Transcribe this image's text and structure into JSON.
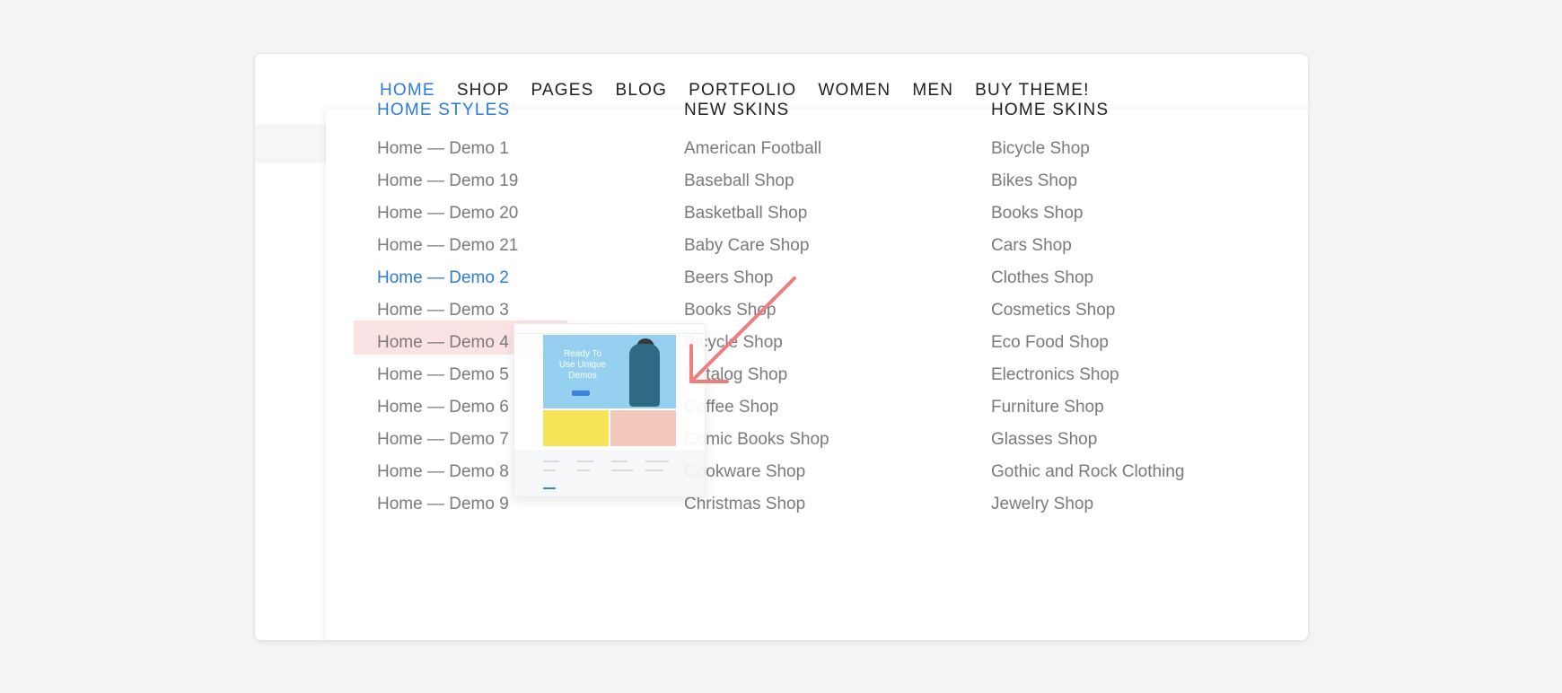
{
  "nav": {
    "items": [
      "HOME",
      "SHOP",
      "PAGES",
      "BLOG",
      "PORTFOLIO",
      "WOMEN",
      "MEN",
      "BUY THEME!"
    ],
    "active_index": 0
  },
  "menu": {
    "columns": [
      {
        "title": "HOME STYLES",
        "items": [
          "Home — Demo 1",
          "Home — Demo 19",
          "Home — Demo 20",
          "Home — Demo 21",
          "Home — Demo 2",
          "Home — Demo 3",
          "Home — Demo 4",
          "Home — Demo 5",
          "Home — Demo 6",
          "Home — Demo 7",
          "Home — Demo 8",
          "Home — Demo 9"
        ]
      },
      {
        "title": "NEW SKINS",
        "items": [
          "American Football",
          "Baseball Shop",
          "Basketball Shop",
          "Baby Care Shop",
          "Beers Shop",
          "Books Shop",
          "Bicycle Shop",
          "Catalog Shop",
          "Coffee Shop",
          "Comic Books Shop",
          "Cookware Shop",
          "Christmas Shop"
        ]
      },
      {
        "title": "HOME SKINS",
        "items": [
          "Bicycle Shop",
          "Bikes Shop",
          "Books Shop",
          "Cars Shop",
          "Clothes Shop",
          "Cosmetics Shop",
          "Eco Food Shop",
          "Electronics Shop",
          "Furniture Shop",
          "Glasses Shop",
          "Gothic and Rock Clothing",
          "Jewelry Shop"
        ]
      }
    ],
    "hovered_item": "Home — Demo 2"
  },
  "preview": {
    "hero_text": "Ready To Use Unique Demos"
  },
  "colors": {
    "accent": "#2b7bd8",
    "highlight": "#fbe3e3",
    "arrow": "#f07c7c"
  }
}
